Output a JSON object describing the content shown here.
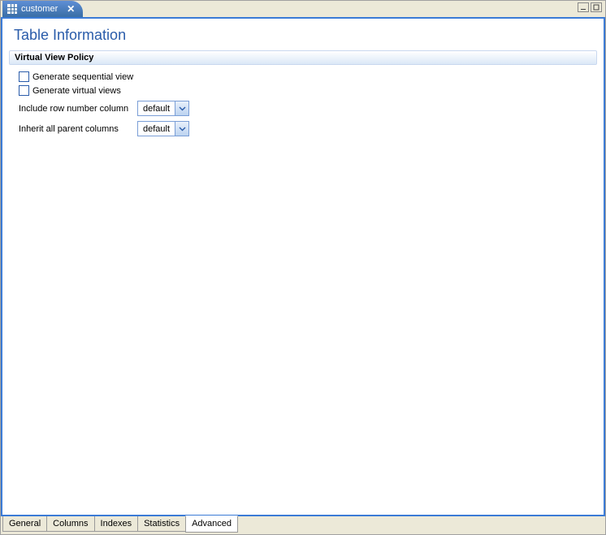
{
  "topTab": {
    "label": "customer"
  },
  "pageTitle": "Table Information",
  "section": {
    "header": "Virtual View Policy",
    "checkboxes": [
      {
        "label": "Generate sequential view",
        "checked": false
      },
      {
        "label": "Generate virtual views",
        "checked": false
      }
    ],
    "fields": [
      {
        "label": "Include row number column",
        "value": "default"
      },
      {
        "label": "Inherit all parent columns",
        "value": "default"
      }
    ]
  },
  "bottomTabs": {
    "items": [
      "General",
      "Columns",
      "Indexes",
      "Statistics",
      "Advanced"
    ],
    "active": "Advanced"
  }
}
